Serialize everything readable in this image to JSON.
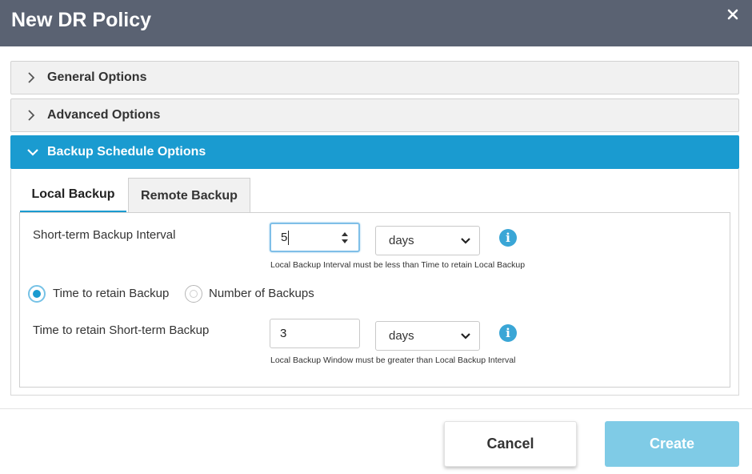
{
  "dialog": {
    "title": "New DR Policy"
  },
  "accordion": {
    "general": "General Options",
    "advanced": "Advanced Options",
    "backup_schedule": "Backup Schedule Options"
  },
  "tabs": {
    "local": "Local Backup",
    "remote": "Remote Backup"
  },
  "form": {
    "interval_label": "Short-term Backup Interval",
    "interval_value": "5",
    "interval_unit": "days",
    "interval_hint": "Local Backup Interval must be less than Time to retain Local Backup",
    "radio_time": "Time to retain Backup",
    "radio_number": "Number of Backups",
    "retain_label": "Time to retain Short-term Backup",
    "retain_value": "3",
    "retain_unit": "days",
    "retain_hint": "Local Backup Window must be greater than Local Backup Interval"
  },
  "footer": {
    "cancel": "Cancel",
    "create": "Create"
  },
  "colors": {
    "titlebar": "#5a6272",
    "accent": "#1a9bd0",
    "create_disabled": "#7fcbe6"
  },
  "icons": {
    "close": "close-icon",
    "collapsed": "chevron-right-icon",
    "expanded": "chevron-down-icon",
    "info": "info-icon",
    "spinner": "spinner-icon"
  }
}
